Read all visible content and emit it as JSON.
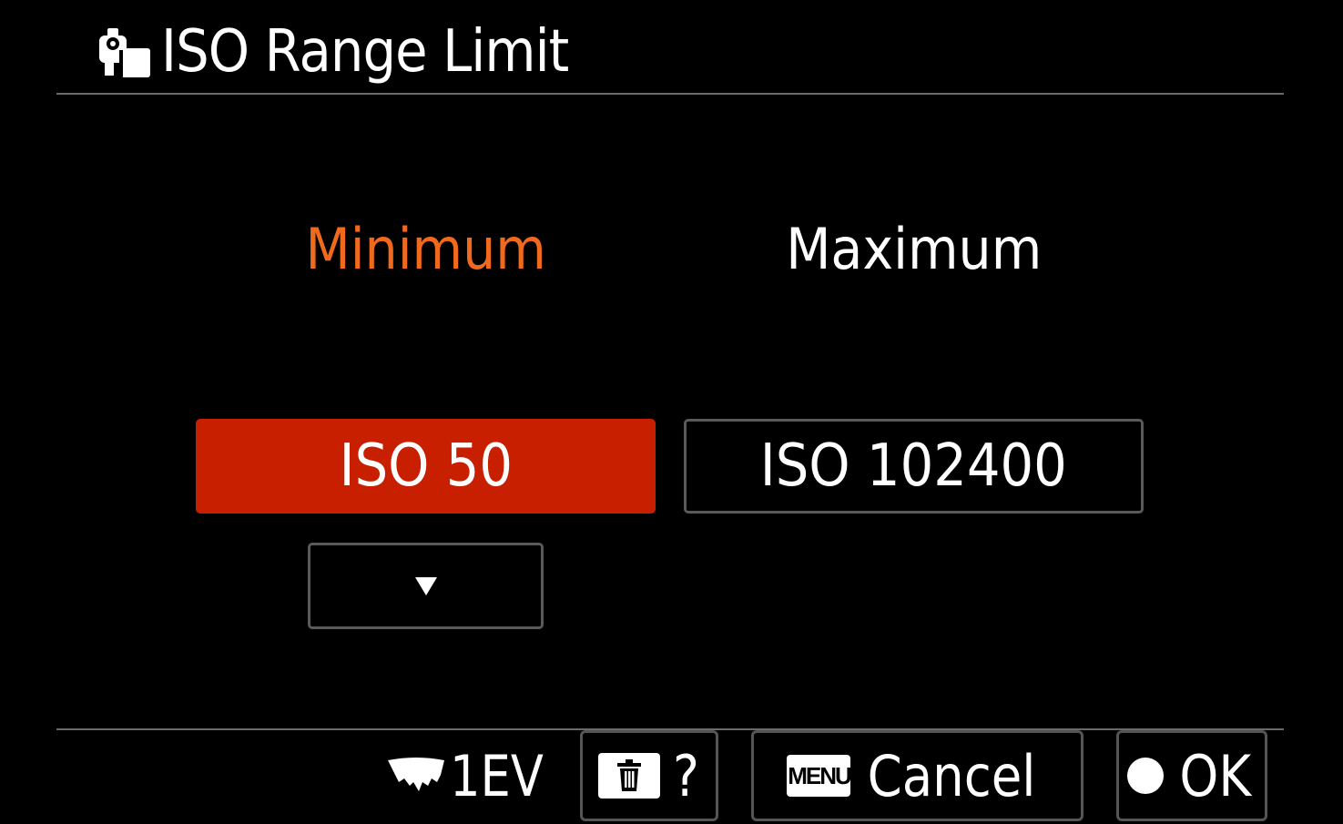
{
  "header": {
    "title": "ISO Range Limit",
    "icon": "camera-settings-icon"
  },
  "range": {
    "minimum_label": "Minimum",
    "maximum_label": "Maximum",
    "minimum_value": "ISO 50",
    "maximum_value": "ISO 102400",
    "selected": "minimum"
  },
  "footer": {
    "step_label": "1EV",
    "help_label": "?",
    "menu_tile": "MENU",
    "cancel_label": "Cancel",
    "ok_label": "OK"
  },
  "colors": {
    "accent": "#f06a1e",
    "selection": "#c81f00",
    "background": "#000000",
    "border": "#5a5a5a"
  }
}
